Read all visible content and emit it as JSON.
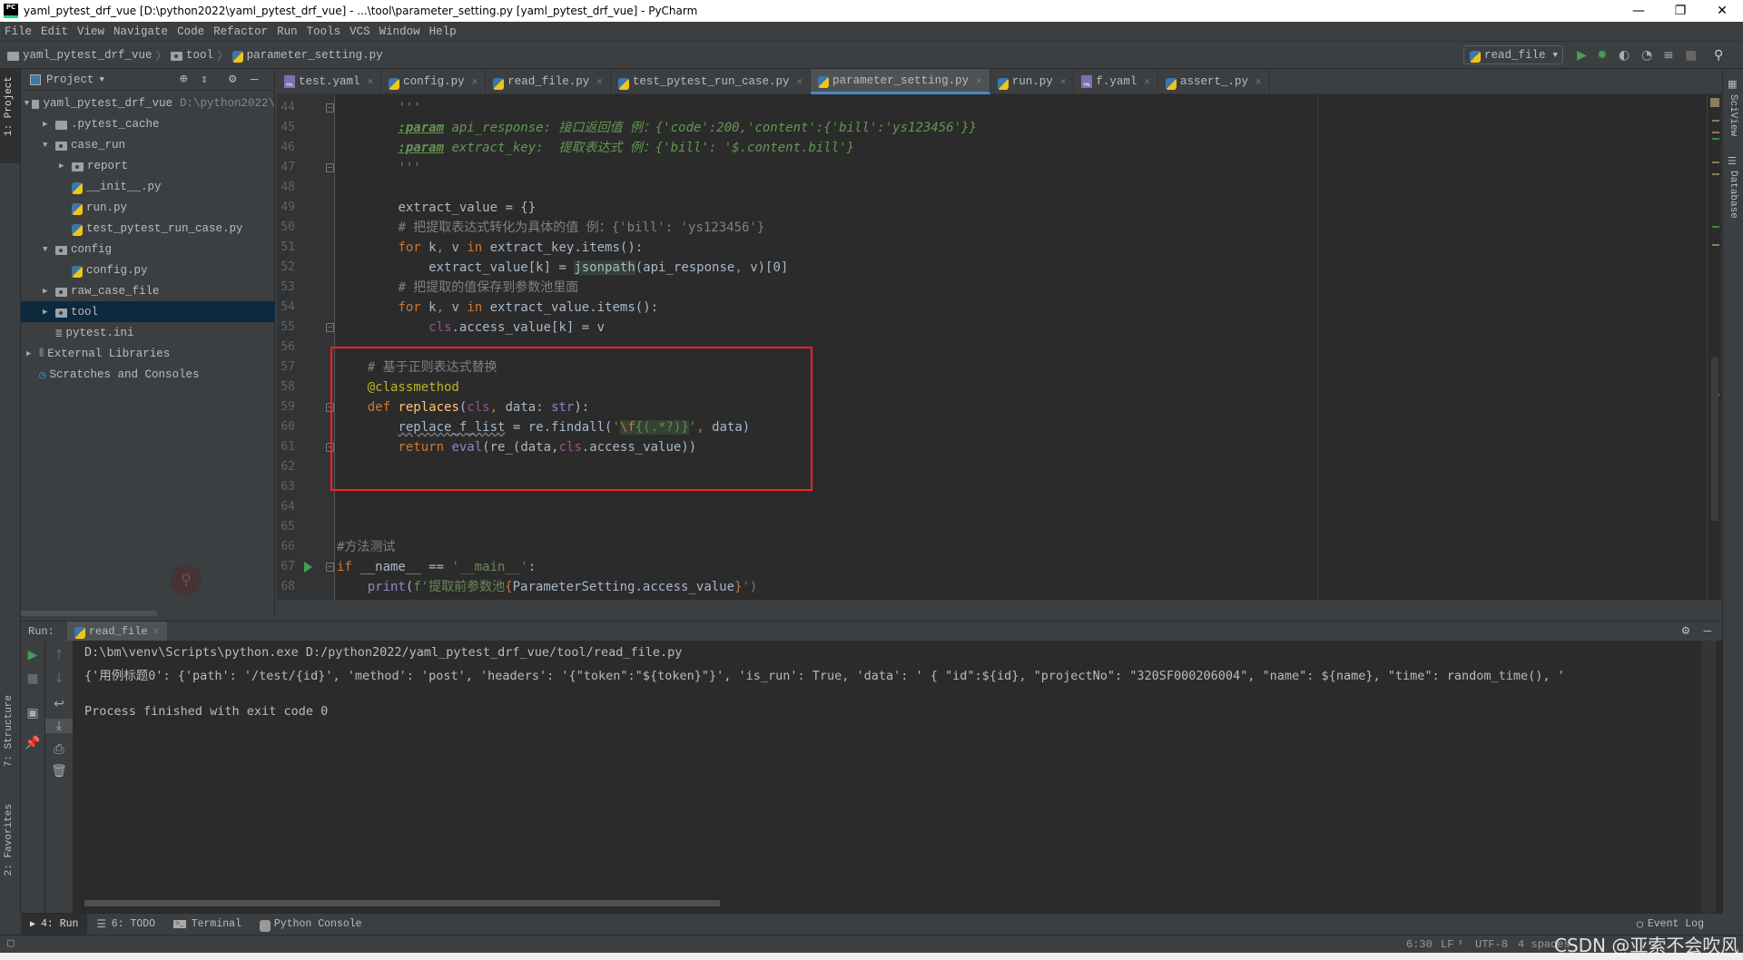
{
  "window": {
    "title": "yaml_pytest_drf_vue [D:\\python2022\\yaml_pytest_drf_vue] - ...\\tool\\parameter_setting.py [yaml_pytest_drf_vue] - PyCharm",
    "logo": "PC",
    "minimize": "—",
    "maximize": "❐",
    "close": "✕"
  },
  "menu": [
    "File",
    "Edit",
    "View",
    "Navigate",
    "Code",
    "Refactor",
    "Run",
    "Tools",
    "VCS",
    "Window",
    "Help"
  ],
  "breadcrumb": [
    "yaml_pytest_drf_vue",
    "tool",
    "parameter_setting.py"
  ],
  "toolbar": {
    "run_config": "read_file",
    "icons": [
      "run-icon",
      "debug-icon",
      "coverage-icon",
      "profile-icon",
      "concurrency-icon",
      "stop-icon",
      "search-icon"
    ]
  },
  "left_strip": {
    "project": "1: Project",
    "structure": "7: Structure",
    "favorites": "2: Favorites"
  },
  "right_strip": {
    "sciview": "SciView",
    "database": "Database"
  },
  "project": {
    "header": "Project",
    "tree": [
      {
        "label": "yaml_pytest_drf_vue",
        "hint": "D:\\python2022\\",
        "type": "folder",
        "level": 0,
        "expanded": true
      },
      {
        "label": ".pytest_cache",
        "type": "folder",
        "level": 1,
        "expanded": false
      },
      {
        "label": "case_run",
        "type": "package",
        "level": 1,
        "expanded": true
      },
      {
        "label": "report",
        "type": "package",
        "level": 2,
        "expanded": false
      },
      {
        "label": "__init__.py",
        "type": "py",
        "level": 2
      },
      {
        "label": "run.py",
        "type": "py",
        "level": 2
      },
      {
        "label": "test_pytest_run_case.py",
        "type": "py",
        "level": 2
      },
      {
        "label": "config",
        "type": "package",
        "level": 1,
        "expanded": true
      },
      {
        "label": "config.py",
        "type": "py",
        "level": 2
      },
      {
        "label": "raw_case_file",
        "type": "package",
        "level": 1,
        "expanded": false
      },
      {
        "label": "tool",
        "type": "package",
        "level": 1,
        "expanded": false,
        "selected": true
      },
      {
        "label": "pytest.ini",
        "type": "ini",
        "level": 1
      },
      {
        "label": "External Libraries",
        "type": "lib",
        "level": 0,
        "expanded": false
      },
      {
        "label": "Scratches and Consoles",
        "type": "scratch",
        "level": 0
      }
    ]
  },
  "tabs": [
    {
      "label": "test.yaml",
      "type": "yaml"
    },
    {
      "label": "config.py",
      "type": "py"
    },
    {
      "label": "read_file.py",
      "type": "py"
    },
    {
      "label": "test_pytest_run_case.py",
      "type": "py"
    },
    {
      "label": "parameter_setting.py",
      "type": "py",
      "active": true
    },
    {
      "label": "run.py",
      "type": "py"
    },
    {
      "label": "f.yaml",
      "type": "yaml"
    },
    {
      "label": "assert_.py",
      "type": "py"
    }
  ],
  "editor": {
    "lines": [
      {
        "n": "44",
        "indent": 8,
        "fold": true,
        "tokens": [
          [
            "'''",
            "doc"
          ]
        ]
      },
      {
        "n": "45",
        "indent": 8,
        "tokens": [
          [
            ":param",
            "doctag"
          ],
          [
            " api_response: 接口返回值 例：{'code':200,'content':{'bill':'ys123456'}}",
            "doc"
          ]
        ]
      },
      {
        "n": "46",
        "indent": 8,
        "tokens": [
          [
            ":param",
            "doctag"
          ],
          [
            " extract_key:  提取表达式 例：{'bill': '$.content.bill'}",
            "doc"
          ]
        ]
      },
      {
        "n": "47",
        "indent": 8,
        "fold": true,
        "tokens": [
          [
            "'''",
            "doc"
          ]
        ]
      },
      {
        "n": "48",
        "indent": 0,
        "tokens": []
      },
      {
        "n": "49",
        "indent": 8,
        "tokens": [
          [
            "extract_value = {}",
            ""
          ]
        ]
      },
      {
        "n": "50",
        "indent": 8,
        "tokens": [
          [
            "# 把提取表达式转化为具体的值 例：{'bill': 'ys123456'}",
            "com"
          ]
        ]
      },
      {
        "n": "51",
        "indent": 8,
        "tokens": [
          [
            "for",
            "kw"
          ],
          [
            " k",
            ""
          ],
          [
            ",",
            "kw"
          ],
          [
            " v ",
            ""
          ],
          [
            "in",
            "kw"
          ],
          [
            " extract_key.items():",
            ""
          ]
        ]
      },
      {
        "n": "52",
        "indent": 12,
        "tokens": [
          [
            "extract_value[k] = ",
            ""
          ],
          [
            "jsonpath",
            "hl"
          ],
          [
            "(api_response",
            ""
          ],
          [
            ", ",
            "kw"
          ],
          [
            "v)[0]",
            ""
          ]
        ]
      },
      {
        "n": "53",
        "indent": 8,
        "tokens": [
          [
            "# 把提取的值保存到参数池里面",
            "com"
          ]
        ]
      },
      {
        "n": "54",
        "indent": 8,
        "tokens": [
          [
            "for",
            "kw"
          ],
          [
            " k",
            ""
          ],
          [
            ",",
            "kw"
          ],
          [
            " v ",
            ""
          ],
          [
            "in",
            "kw"
          ],
          [
            " extract_value.items():",
            ""
          ]
        ]
      },
      {
        "n": "55",
        "indent": 12,
        "fold": true,
        "tokens": [
          [
            "cls",
            "self"
          ],
          [
            ".access_value[k] = v",
            ""
          ]
        ]
      },
      {
        "n": "56",
        "indent": 0,
        "tokens": []
      },
      {
        "n": "57",
        "indent": 4,
        "tokens": [
          [
            "# 基于正则表达式替换",
            "com"
          ]
        ]
      },
      {
        "n": "58",
        "indent": 4,
        "tokens": [
          [
            "@classmethod",
            "dec"
          ]
        ]
      },
      {
        "n": "59",
        "indent": 4,
        "fold": true,
        "tokens": [
          [
            "def",
            "kw"
          ],
          [
            " ",
            ""
          ],
          [
            "replaces",
            "fn"
          ],
          [
            "(",
            ""
          ],
          [
            "cls",
            "self"
          ],
          [
            ", ",
            "kw"
          ],
          [
            "data: ",
            ""
          ],
          [
            "str",
            "bi"
          ],
          [
            "):",
            ""
          ]
        ]
      },
      {
        "n": "60",
        "indent": 8,
        "tokens": [
          [
            "replace_f_list",
            "warn"
          ],
          [
            " = re.findall(",
            ""
          ],
          [
            "'",
            "str"
          ],
          [
            "\\f",
            "esc"
          ],
          [
            "{(.*?)}",
            "rx"
          ],
          [
            "'",
            "str"
          ],
          [
            ", ",
            "kw"
          ],
          [
            "data)",
            ""
          ]
        ]
      },
      {
        "n": "61",
        "indent": 8,
        "fold": true,
        "tokens": [
          [
            "return",
            "kw"
          ],
          [
            " ",
            ""
          ],
          [
            "eval",
            "bi"
          ],
          [
            "(re_(data,",
            ""
          ],
          [
            "cls",
            "self"
          ],
          [
            ".access_value))",
            ""
          ]
        ]
      },
      {
        "n": "62",
        "indent": 0,
        "tokens": []
      },
      {
        "n": "63",
        "indent": 0,
        "tokens": []
      },
      {
        "n": "64",
        "indent": 0,
        "tokens": []
      },
      {
        "n": "65",
        "indent": 0,
        "tokens": []
      },
      {
        "n": "66",
        "indent": 0,
        "tokens": [
          [
            "#方法测试",
            "com"
          ]
        ]
      },
      {
        "n": "67",
        "indent": 0,
        "fold": true,
        "run": true,
        "tokens": [
          [
            "if",
            "kw"
          ],
          [
            " __name__ == ",
            ""
          ],
          [
            "'__main__'",
            "str"
          ],
          [
            ":",
            ""
          ]
        ]
      },
      {
        "n": "68",
        "indent": 4,
        "tokens": [
          [
            "print",
            "bi"
          ],
          [
            "(",
            ""
          ],
          [
            "f'提取前参数池",
            "str"
          ],
          [
            "{",
            "kw"
          ],
          [
            "ParameterSetting.access_value",
            ""
          ],
          [
            "}",
            "kw"
          ],
          [
            "')",
            "str"
          ]
        ]
      }
    ]
  },
  "run_panel": {
    "label": "Run:",
    "tab": "read_file",
    "output": [
      "D:\\bm\\venv\\Scripts\\python.exe D:/python2022/yaml_pytest_drf_vue/tool/read_file.py",
      "{'用例标题0': {'path': '/test/{id}', 'method': 'post', 'headers': '{\"token\":\"${token}\"}', 'is_run': True, 'data': ' { \"id\":${id}, \"projectNo\": \"320SF000206004\", \"name\": ${name}, \"time\": random_time(), '",
      "",
      "Process finished with exit code 0"
    ]
  },
  "bottom_tabs": [
    "4: Run",
    "6: TODO",
    "Terminal",
    "Python Console"
  ],
  "event_log": "Event Log",
  "status": {
    "position": "6:30",
    "line_sep": "LF",
    "encoding": "UTF-8",
    "indent": "4 spaces"
  },
  "watermark": "CSDN @亚索不会吹风"
}
